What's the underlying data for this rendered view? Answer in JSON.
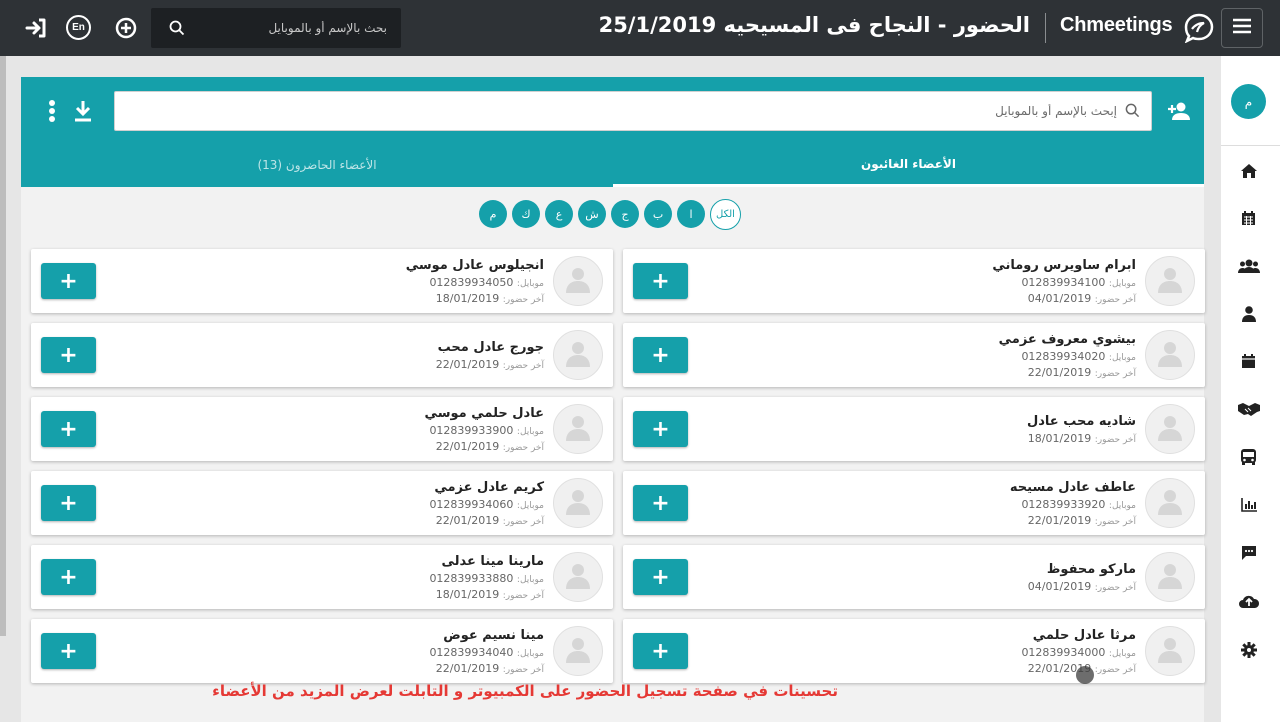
{
  "topbar": {
    "search_placeholder": "بحث بالإسم أو بالموبايل",
    "lang_label": "En",
    "title": "الحضور  -  النجاح فى المسيحيه 25/1/2019",
    "brand": "Chmeetings",
    "icons": [
      "logout-icon",
      "language-icon",
      "add-circle-icon",
      "search-icon",
      "brand-logo-icon",
      "menu-icon"
    ]
  },
  "panel": {
    "search_placeholder": "إبحث بالإسم أو بالموبايل",
    "tabs": [
      {
        "label": "الأعضاء الغائبون",
        "active": true
      },
      {
        "label": "الأعضاء الحاضرون (13)",
        "active": false
      }
    ],
    "letters": [
      "الكل",
      "ا",
      "ب",
      "ج",
      "ش",
      "ع",
      "ك",
      "م"
    ],
    "accent_color": "#15a0aa"
  },
  "members": [
    {
      "name": "ابرام ساويرس روماني",
      "mobile_label": "موبايل:",
      "mobile": "012839934100",
      "last_label": "آخر حضور:",
      "last": "04/01/2019"
    },
    {
      "name": "انجيلوس عادل موسي",
      "mobile_label": "موبايل:",
      "mobile": "012839934050",
      "last_label": "آخر حضور:",
      "last": "18/01/2019"
    },
    {
      "name": "بيشوي معروف عزمي",
      "mobile_label": "موبايل:",
      "mobile": "012839934020",
      "last_label": "آخر حضور:",
      "last": "22/01/2019"
    },
    {
      "name": "جورج عادل محب",
      "mobile_label": "",
      "mobile": "",
      "last_label": "آخر حضور:",
      "last": "22/01/2019"
    },
    {
      "name": "شاديه محب عادل",
      "mobile_label": "",
      "mobile": "",
      "last_label": "آخر حضور:",
      "last": "18/01/2019"
    },
    {
      "name": "عادل حلمي موسي",
      "mobile_label": "موبايل:",
      "mobile": "012839933900",
      "last_label": "آخر حضور:",
      "last": "22/01/2019"
    },
    {
      "name": "عاطف عادل مسيحه",
      "mobile_label": "موبايل:",
      "mobile": "012839933920",
      "last_label": "آخر حضور:",
      "last": "22/01/2019"
    },
    {
      "name": "كريم عادل عزمي",
      "mobile_label": "موبايل:",
      "mobile": "012839934060",
      "last_label": "آخر حضور:",
      "last": "22/01/2019"
    },
    {
      "name": "ماركو محفوظ",
      "mobile_label": "",
      "mobile": "",
      "last_label": "آخر حضور:",
      "last": "04/01/2019"
    },
    {
      "name": "مارينا مينا عدلى",
      "mobile_label": "موبايل:",
      "mobile": "012839933880",
      "last_label": "آخر حضور:",
      "last": "18/01/2019"
    },
    {
      "name": "مرثا عادل حلمي",
      "mobile_label": "موبايل:",
      "mobile": "012839934000",
      "last_label": "آخر حضور:",
      "last": "22/01/2019"
    },
    {
      "name": "مينا نسيم عوض",
      "mobile_label": "موبايل:",
      "mobile": "012839934040",
      "last_label": "آخر حضور:",
      "last": "22/01/2019"
    }
  ],
  "add_label": "+",
  "rail": {
    "avatar_letter": "م",
    "items": [
      "home-icon",
      "calendar-icon",
      "groups-icon",
      "person-icon",
      "event-icon",
      "handshake-icon",
      "bus-icon",
      "report-icon",
      "chat-icon",
      "cloud-upload-icon",
      "settings-icon"
    ]
  },
  "footer_note": "تحسينات في صفحة تسجيل الحضور على الكمبيوتر و التابلت لعرض المزيد من الأعضاء"
}
